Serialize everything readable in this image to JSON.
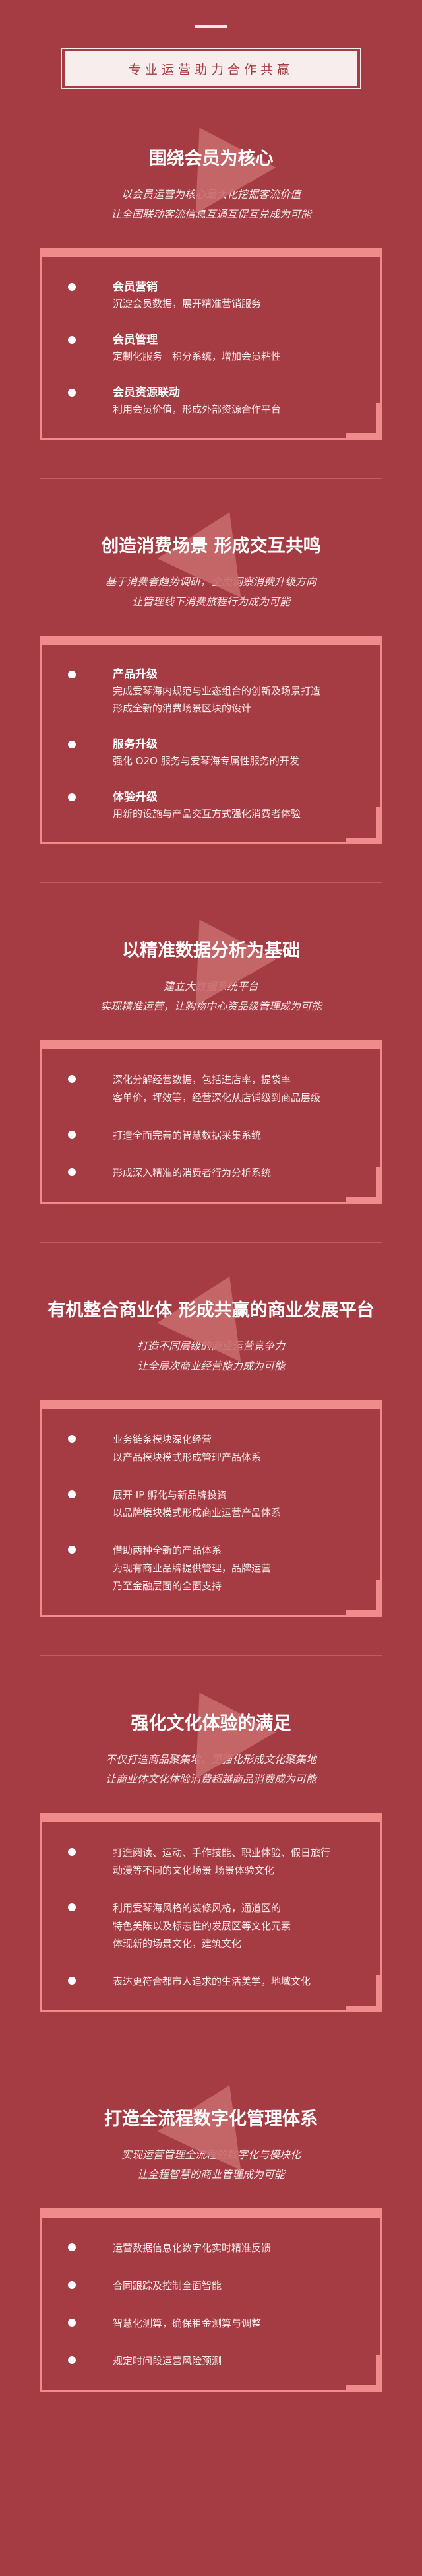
{
  "header": {
    "title": "专业运营助力合作共赢"
  },
  "sections": [
    {
      "title": "围绕会员为核心",
      "subtitle": [
        "以会员运营为核心最大化挖掘客流价值",
        "让全国联动客流信息互通互促互兑成为可能"
      ],
      "items": [
        {
          "head": "会员营销",
          "desc": [
            "沉淀会员数据，展开精准营销服务"
          ]
        },
        {
          "head": "会员管理",
          "desc": [
            "定制化服务＋积分系统，增加会员粘性"
          ]
        },
        {
          "head": "会员资源联动",
          "desc": [
            "利用会员价值，形成外部资源合作平台"
          ]
        }
      ]
    },
    {
      "title": "创造消费场景 形成交互共鸣",
      "subtitle": [
        "基于消费者趋势调研，全面洞察消费升级方向",
        "让管理线下消费旅程行为成为可能"
      ],
      "items": [
        {
          "head": "产品升级",
          "desc": [
            "完成爱琴海内规范与业态组合的创新及场景打造",
            "形成全新的消费场景区块的设计"
          ]
        },
        {
          "head": "服务升级",
          "desc": [
            "强化 O2O 服务与爱琴海专属性服务的开发"
          ]
        },
        {
          "head": "体验升级",
          "desc": [
            "用新的设施与产品交互方式强化消费者体验"
          ]
        }
      ]
    },
    {
      "title": "以精准数据分析为基础",
      "subtitle": [
        "建立大数据系统平台",
        "实现精准运营，让购物中心资品级管理成为可能"
      ],
      "items": [
        {
          "desc": [
            "深化分解经营数据，包括进店率，提袋率",
            "客单价，坪效等，经营深化从店铺级到商品层级"
          ]
        },
        {
          "desc": [
            "打造全面完善的智慧数据采集系统"
          ]
        },
        {
          "desc": [
            "形成深入精准的消费者行为分析系统"
          ]
        }
      ]
    },
    {
      "title": "有机整合商业体 形成共赢的商业发展平台",
      "subtitle": [
        "打造不同层级的商业运营竞争力",
        "让全层次商业经营能力成为可能"
      ],
      "items": [
        {
          "desc": [
            "业务链条模块深化经营",
            "以产品模块模式形成管理产品体系"
          ]
        },
        {
          "desc": [
            "展开 IP 孵化与新品牌投资",
            "以品牌模块模式形成商业运营产品体系"
          ]
        },
        {
          "desc": [
            "借助两种全新的产品体系",
            "为现有商业品牌提供管理，品牌运营",
            "乃至金融层面的全面支持"
          ]
        }
      ]
    },
    {
      "title": "强化文化体验的满足",
      "subtitle": [
        "不仅打造商品聚集地，更强化形成文化聚集地",
        "让商业体文化体验消费超越商品消费成为可能"
      ],
      "items": [
        {
          "desc": [
            "打造阅读、运动、手作技能、职业体验、假日旅行",
            "动漫等不同的文化场景  场景体验文化"
          ]
        },
        {
          "desc": [
            "利用爱琴海风格的装修风格，通道区的",
            "特色美陈以及标志性的发展区等文化元素",
            "体现新的场景文化，建筑文化"
          ]
        },
        {
          "desc": [
            "表达更符合都市人追求的生活美学，地域文化"
          ]
        }
      ]
    },
    {
      "title": "打造全流程数字化管理体系",
      "subtitle": [
        "实现运营管理全流程的数字化与模块化",
        "让全程智慧的商业管理成为可能"
      ],
      "items": [
        {
          "desc": [
            "运营数据信息化数字化实时精准反馈"
          ]
        },
        {
          "desc": [
            "合同跟踪及控制全面智能"
          ]
        },
        {
          "desc": [
            "智慧化测算，确保租金测算与调整"
          ]
        },
        {
          "desc": [
            "规定时间段运营风险预测"
          ]
        }
      ]
    }
  ]
}
